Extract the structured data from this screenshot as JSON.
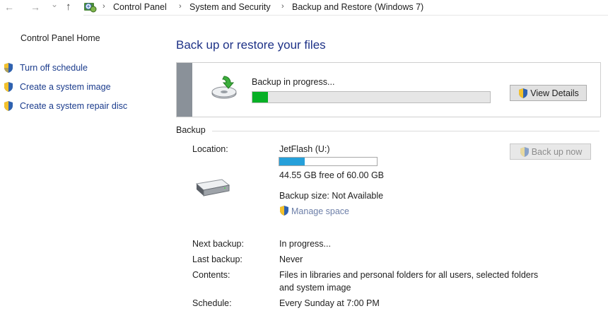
{
  "address_bar": {
    "back_glyph": "←",
    "forward_glyph": "→",
    "dropdown_glyph": "⌄",
    "up_glyph": "↑",
    "separator": "›",
    "crumbs": [
      "Control Panel",
      "System and Security",
      "Backup and Restore (Windows 7)"
    ]
  },
  "sidebar": {
    "home": "Control Panel Home",
    "links": [
      {
        "label": "Turn off schedule",
        "icon": "uac-shield-icon"
      },
      {
        "label": "Create a system image",
        "icon": "uac-shield-icon"
      },
      {
        "label": "Create a system repair disc",
        "icon": "uac-shield-icon"
      }
    ]
  },
  "main": {
    "title": "Back up or restore your files",
    "status": {
      "text": "Backup in progress...",
      "progress_fraction": 0.065,
      "view_details_label": "View Details"
    },
    "backup": {
      "section_label": "Backup",
      "location_label": "Location:",
      "location_value": "JetFlash (U:)",
      "used_fraction": 0.26,
      "free_text": "44.55 GB free of 60.00 GB",
      "size_text": "Backup size: Not Available",
      "manage_space_label": "Manage space",
      "back_up_now_label": "Back up now",
      "next_label": "Next backup:",
      "next_value": "In progress...",
      "last_label": "Last backup:",
      "last_value": "Never",
      "contents_label": "Contents:",
      "contents_line1": "Files in libraries and personal folders for all users, selected folders",
      "contents_line2": "and system image",
      "schedule_label": "Schedule:",
      "schedule_value": "Every Sunday at 7:00 PM"
    }
  },
  "colors": {
    "link": "#1a3b8c",
    "title": "#1e3287",
    "progress_green": "#06b025",
    "capacity_blue": "#26a0da"
  }
}
